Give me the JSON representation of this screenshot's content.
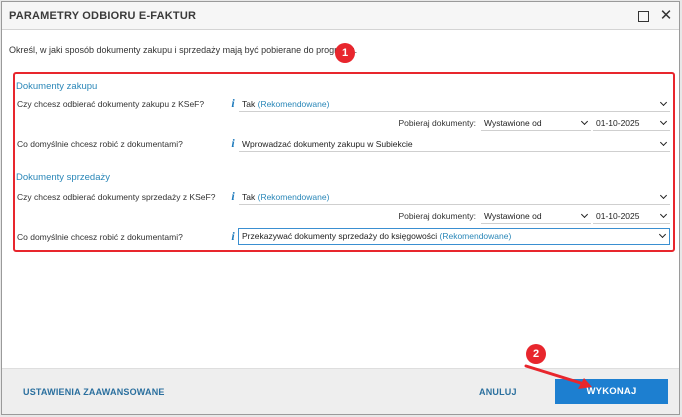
{
  "window": {
    "title": "PARAMETRY ODBIORU E-FAKTUR"
  },
  "intro_text": "Określ, w jaki sposób dokumenty zakupu i sprzedaży mają być pobierane do programu.",
  "callouts": [
    "1",
    "2"
  ],
  "purchase": {
    "title": "Dokumenty zakupu",
    "receive_label": "Czy chcesz odbierać dokumenty zakupu z KSeF?",
    "receive_value": "Tak",
    "receive_recommended": "(Rekomendowane)",
    "fetch_label": "Pobieraj dokumenty:",
    "fetch_mode": "Wystawione od",
    "fetch_date": "01-10-2025",
    "default_label": "Co domyślnie chcesz robić z dokumentami?",
    "default_value": "Wprowadzać dokumenty zakupu w Subiekcie",
    "default_recommended": ""
  },
  "sales": {
    "title": "Dokumenty sprzedaży",
    "receive_label": "Czy chcesz odbierać dokumenty sprzedaży z KSeF?",
    "receive_value": "Tak",
    "receive_recommended": "(Rekomendowane)",
    "fetch_label": "Pobieraj dokumenty:",
    "fetch_mode": "Wystawione od",
    "fetch_date": "01-10-2025",
    "default_label": "Co domyślnie chcesz robić z dokumentami?",
    "default_value": "Przekazywać dokumenty sprzedaży do księgowości",
    "default_recommended": "(Rekomendowane)"
  },
  "footer": {
    "advanced_label": "USTAWIENIA ZAAWANSOWANE",
    "cancel_label": "ANULUJ",
    "execute_label": "WYKONAJ"
  },
  "colors": {
    "accent": "#1d7fd0",
    "section_title": "#2a87b8",
    "highlight": "#e8262d"
  },
  "icons": {
    "info": "i"
  }
}
